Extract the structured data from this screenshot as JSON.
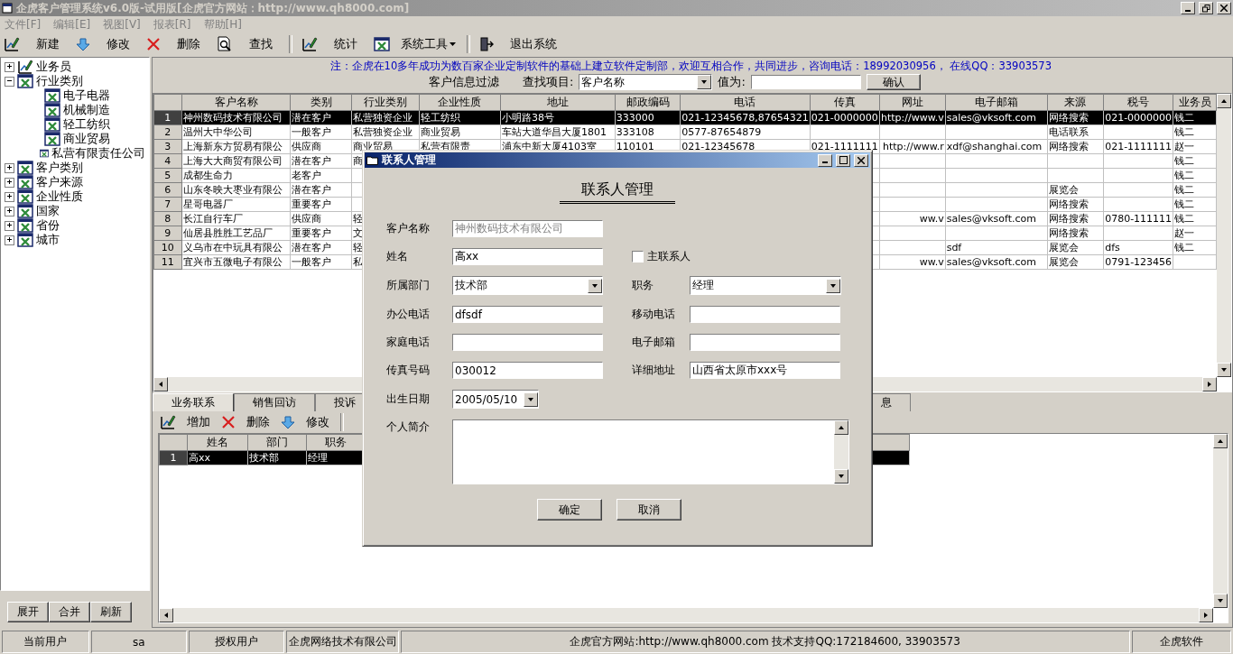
{
  "window": {
    "title": "企虎客户管理系统v6.0版-试用版[企虎官方网站：http://www.qh8000.com]"
  },
  "menu": [
    {
      "label": "文件[F]",
      "disabled": true
    },
    {
      "label": "编辑[E]",
      "disabled": true
    },
    {
      "label": "视图[V]",
      "disabled": true
    },
    {
      "label": "报表[R]",
      "disabled": true
    },
    {
      "label": "帮助[H]",
      "disabled": true
    }
  ],
  "toolbar": [
    {
      "kind": "pen"
    },
    {
      "kind": "label",
      "label": "新建"
    },
    {
      "kind": "arrow"
    },
    {
      "kind": "label",
      "label": "修改"
    },
    {
      "kind": "cross"
    },
    {
      "kind": "label",
      "label": "删除"
    },
    {
      "kind": "magnifier"
    },
    {
      "kind": "label",
      "label": "查找"
    },
    {
      "kind": "separator"
    },
    {
      "kind": "pen"
    },
    {
      "kind": "label",
      "label": "统计"
    },
    {
      "kind": "sheet"
    },
    {
      "kind": "menu",
      "label": "系统工具"
    },
    {
      "kind": "separator"
    },
    {
      "kind": "door"
    },
    {
      "kind": "label",
      "label": "退出系统"
    }
  ],
  "tree": [
    {
      "label": "业务员",
      "kind": "staff",
      "expanded": false
    },
    {
      "label": "行业类别",
      "kind": "table",
      "expanded": true,
      "children": [
        {
          "label": "电子电器",
          "kind": "table"
        },
        {
          "label": "机械制造",
          "kind": "table"
        },
        {
          "label": "轻工纺织",
          "kind": "table"
        },
        {
          "label": "商业贸易",
          "kind": "table"
        },
        {
          "label": "私营有限责任公司",
          "kind": "table"
        }
      ]
    },
    {
      "label": "客户类别",
      "kind": "table",
      "expanded": false
    },
    {
      "label": "客户来源",
      "kind": "table",
      "expanded": false
    },
    {
      "label": "企业性质",
      "kind": "table",
      "expanded": false
    },
    {
      "label": "国家",
      "kind": "table",
      "expanded": false
    },
    {
      "label": "省份",
      "kind": "table",
      "expanded": false
    },
    {
      "label": "城市",
      "kind": "table",
      "expanded": false
    }
  ],
  "tree_buttons": [
    "展开",
    "合并",
    "刷新"
  ],
  "notice": "注：企虎在10多年成功为数百家企业定制软件的基础上建立软件定制部，欢迎互相合作，共同进步，咨询电话：18992030956，  在线QQ：33903573",
  "filter": {
    "title": "客户信息过滤",
    "field_label": "查找项目:",
    "field_value": "客户名称",
    "value_label": "值为:",
    "button": "确认"
  },
  "customers": {
    "columns": [
      "",
      "客户名称",
      "类别",
      "行业类别",
      "企业性质",
      "地址",
      "邮政编码",
      "电话",
      "传真",
      "网址",
      "电子邮箱",
      "来源",
      "税号",
      "业务员"
    ],
    "rows": [
      {
        "selected": true,
        "cells": [
          "1",
          "神州数码技术有限公司",
          "潜在客户",
          "私营独资企业",
          "轻工纺织",
          "小明路38号",
          "333000",
          "021-12345678,87654321",
          "021-0000000",
          "http://www.v",
          "sales@vksoft.com",
          "网络搜索",
          "021-0000000",
          "钱二"
        ]
      },
      {
        "selected": false,
        "cells": [
          "2",
          "温州大中华公司",
          "一般客户",
          "私营独资企业",
          "商业贸易",
          "车站大道华昌大厦1801",
          "333108",
          "0577-87654879",
          null,
          null,
          null,
          "电话联系",
          null,
          "钱二"
        ]
      },
      {
        "selected": false,
        "cells": [
          "3",
          "上海新东方贸易有限公",
          "供应商",
          "商业贸易",
          "私营有限责",
          "浦东中新大厦4103室",
          "110101",
          "021-12345678",
          "021-1111111",
          "http://www.r",
          "xdf@shanghai.com",
          "网络搜索",
          "021-1111111",
          "赵一"
        ]
      },
      {
        "selected": false,
        "cells": [
          "4",
          "上海大大商贸有限公司",
          "潜在客户",
          "商",
          null,
          null,
          null,
          null,
          null,
          null,
          null,
          null,
          null,
          "钱二"
        ]
      },
      {
        "selected": false,
        "cells": [
          "5",
          "成都生命力",
          "老客户",
          null,
          null,
          null,
          null,
          null,
          null,
          null,
          null,
          null,
          null,
          "钱二"
        ]
      },
      {
        "selected": false,
        "cells": [
          "6",
          "山东冬映大枣业有限公",
          "潜在客户",
          null,
          null,
          null,
          null,
          null,
          null,
          null,
          null,
          "展览会",
          null,
          "钱二"
        ]
      },
      {
        "selected": false,
        "cells": [
          "7",
          "星哥电器厂",
          "重要客户",
          null,
          null,
          null,
          null,
          null,
          null,
          null,
          null,
          "网络搜索",
          null,
          "钱二"
        ]
      },
      {
        "selected": false,
        "cells": [
          "8",
          "长江自行车厂",
          "供应商",
          "轻",
          null,
          null,
          null,
          null,
          null,
          "ww.v",
          "sales@vksoft.com",
          "网络搜索",
          "0780-111111",
          "钱二"
        ]
      },
      {
        "selected": false,
        "cells": [
          "9",
          "仙居县胜胜工艺品厂",
          "重要客户",
          "文",
          null,
          null,
          null,
          null,
          null,
          null,
          null,
          "网络搜索",
          null,
          "赵一"
        ]
      },
      {
        "selected": false,
        "cells": [
          "10",
          "义乌市在中玩具有限公",
          "潜在客户",
          "轻",
          null,
          null,
          null,
          null,
          null,
          null,
          "sdf",
          "展览会",
          "dfs",
          "钱二"
        ]
      },
      {
        "selected": false,
        "cells": [
          "11",
          "宜兴市五微电子有限公",
          "一般客户",
          "私",
          null,
          null,
          null,
          null,
          null,
          "ww.v",
          "sales@vksoft.com",
          "展览会",
          "0791-123456",
          null
        ]
      }
    ]
  },
  "tabs": [
    {
      "label": "业务联系",
      "selected": true
    },
    {
      "label": "销售回访",
      "selected": false
    },
    {
      "label": "投诉",
      "selected": false
    },
    {
      "label": "息",
      "selected": false
    }
  ],
  "sub_toolbar": [
    {
      "kind": "pen"
    },
    {
      "kind": "label",
      "label": "增加"
    },
    {
      "kind": "cross"
    },
    {
      "kind": "label",
      "label": "删除"
    },
    {
      "kind": "arrow"
    },
    {
      "kind": "label",
      "label": "修改"
    },
    {
      "kind": "separator"
    }
  ],
  "contacts": {
    "columns": [
      "",
      "姓名",
      "部门",
      "职务"
    ],
    "rows": [
      {
        "selected": true,
        "cells": [
          "1",
          "高xx",
          "技术部",
          "经理"
        ]
      }
    ]
  },
  "status_bar": [
    "当前用户",
    "sa",
    "授权用户",
    "企虎网络技术有限公司",
    "企虎官方网站:http://www.qh8000.com   技术支持QQ:172184600, 33903573",
    "企虎软件"
  ],
  "dialog": {
    "title": "联系人管理",
    "heading": "联系人管理",
    "rows": [
      [
        {
          "kind": "text",
          "label": "客户名称",
          "value": "神州数码技术有限公司",
          "disabled": true
        }
      ],
      [
        {
          "kind": "text",
          "label": "姓名",
          "value": "高xx"
        },
        {
          "kind": "checkbox",
          "label": "主联系人",
          "checked": false
        }
      ],
      [
        {
          "kind": "combo",
          "label": "所属部门",
          "value": "技术部"
        },
        {
          "kind": "combo",
          "label": "职务",
          "value": "经理"
        }
      ],
      [
        {
          "kind": "text",
          "label": "办公电话",
          "value": "dfsdf"
        },
        {
          "kind": "text",
          "label": "移动电话"
        }
      ],
      [
        {
          "kind": "text",
          "label": "家庭电话"
        },
        {
          "kind": "text",
          "label": "电子邮箱"
        }
      ],
      [
        {
          "kind": "text",
          "label": "传真号码",
          "value": "030012"
        },
        {
          "kind": "text",
          "label": "详细地址",
          "value": "山西省太原市xxx号"
        }
      ],
      [
        {
          "kind": "date",
          "label": "出生日期",
          "value": "2005/05/10"
        }
      ],
      [
        {
          "kind": "textarea",
          "label": "个人简介"
        }
      ]
    ],
    "buttons": [
      "确定",
      "取消"
    ]
  }
}
